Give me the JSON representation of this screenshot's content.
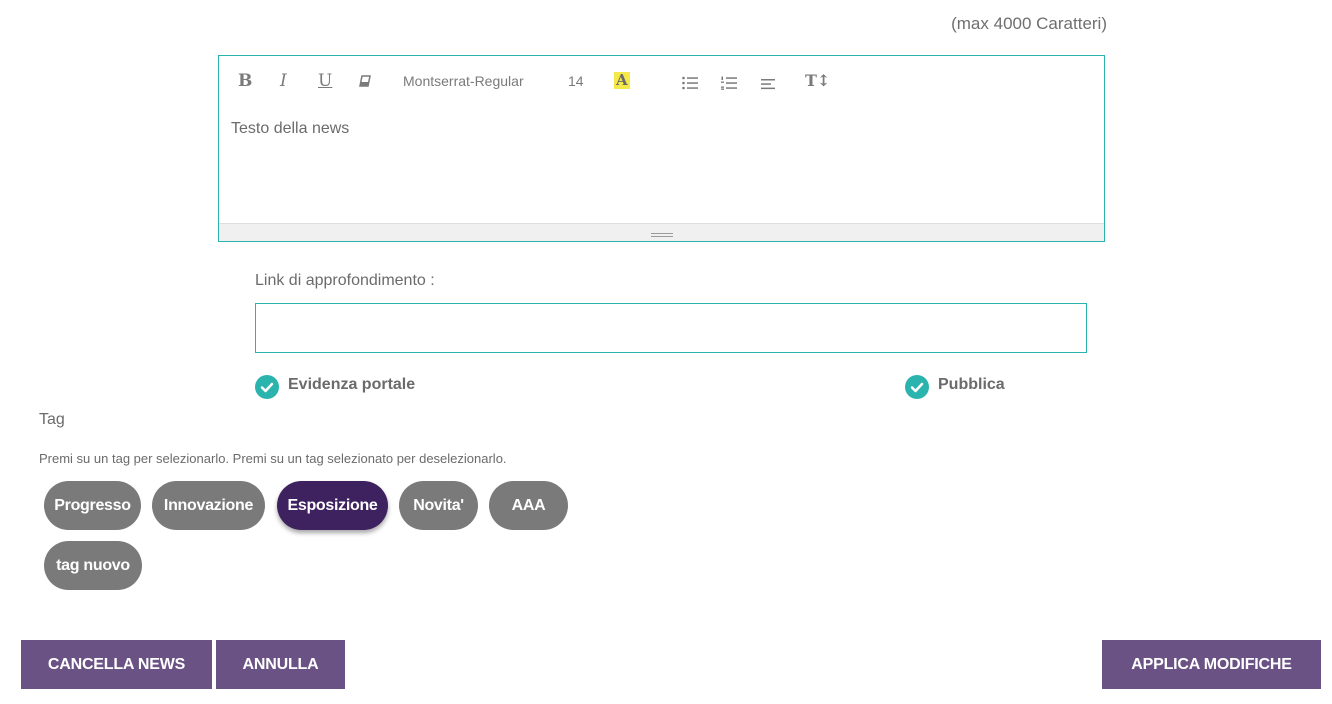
{
  "editor": {
    "max_chars": "(max 4000 Caratteri)",
    "toolbar": {
      "bold": "B",
      "italic": "I",
      "underline": "U",
      "font": "Montserrat-Regular",
      "size": "14",
      "highlight": "A",
      "text_size": "T↕"
    },
    "content": "Testo della news"
  },
  "link": {
    "label": "Link di approfondimento :",
    "value": ""
  },
  "options": {
    "evidenza": "Evidenza portale",
    "pubblica": "Pubblica"
  },
  "tags": {
    "title": "Tag",
    "hint": "Premi su un tag per selezionarlo. Premi su un tag selezionato per deselezionarlo.",
    "items": [
      {
        "label": "Progresso",
        "selected": false
      },
      {
        "label": "Innovazione",
        "selected": false
      },
      {
        "label": "Esposizione",
        "selected": true
      },
      {
        "label": "Novita'",
        "selected": false
      },
      {
        "label": "AAA",
        "selected": false
      },
      {
        "label": "tag nuovo",
        "selected": false
      }
    ]
  },
  "buttons": {
    "delete": "CANCELLA NEWS",
    "cancel": "ANNULLA",
    "apply": "APPLICA MODIFICHE"
  },
  "colors": {
    "accent": "#2bb3ad",
    "tag_default": "#7a7a7a",
    "tag_selected": "#3e2260",
    "button": "#6b5285"
  }
}
